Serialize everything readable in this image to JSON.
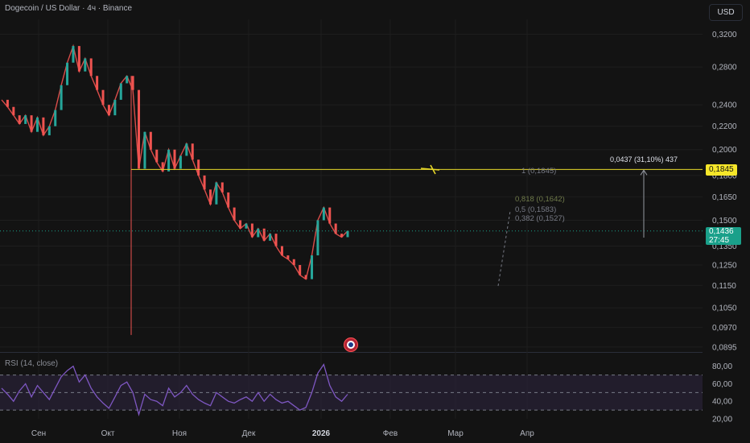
{
  "header": {
    "title": "Dogecoin / US Dollar · 4ч · Binance",
    "currency_button": "USD"
  },
  "colors": {
    "background": "#131313",
    "grid": "#1e1e1e",
    "candle_up": "#26a69a",
    "candle_down": "#ef5350",
    "level_line": "#e6d729",
    "rsi_line": "#7e57c2",
    "rsi_band": "#2a2238",
    "current_price": "#1aa08a"
  },
  "price_axis": {
    "ticks": [
      "0,3200",
      "0,2800",
      "0,2400",
      "0,2200",
      "0,2000",
      "0,1800",
      "0,1650",
      "0,1500",
      "0,1350",
      "0,1250",
      "0,1150",
      "0,1050",
      "0,0970",
      "0,0895"
    ]
  },
  "time_axis": {
    "ticks": [
      "Сен",
      "Окт",
      "Ноя",
      "Дек",
      "2026",
      "Фев",
      "Мар",
      "Апр"
    ]
  },
  "rsi": {
    "label": "RSI (14, close)",
    "ticks": [
      "80,00",
      "60,00",
      "40,00",
      "20,00"
    ]
  },
  "annotations": {
    "level_price_tag": "0,1845",
    "current_price_tag": "0,1436",
    "countdown": "27:45",
    "measure_label": "0,0437 (31,10%) 437",
    "fib_1": "1 (0,1845)",
    "fib_0818": "0,818 (0,1642)",
    "fib_05": "0,5 (0,1583)",
    "fib_0382": "0,382 (0,1527)"
  },
  "chart_data": {
    "type": "line",
    "title": "Dogecoin / US Dollar · 4ч · Binance",
    "xlabel": "",
    "ylabel": "",
    "log_scale": true,
    "ylim": [
      0.088,
      0.34
    ],
    "x_categories": [
      "Сен",
      "Окт",
      "Ноя",
      "Дек",
      "2026",
      "Фев",
      "Мар",
      "Апр"
    ],
    "series": [
      {
        "values": [
          0.245,
          0.238,
          0.23,
          0.222,
          0.23,
          0.215,
          0.228,
          0.212,
          0.22,
          0.235,
          0.26,
          0.285,
          0.305,
          0.275,
          0.29,
          0.27,
          0.255,
          0.24,
          0.23,
          0.245,
          0.262,
          0.27,
          0.255,
          0.185,
          0.215,
          0.2,
          0.19,
          0.183,
          0.2,
          0.185,
          0.195,
          0.205,
          0.192,
          0.18,
          0.17,
          0.16,
          0.175,
          0.168,
          0.158,
          0.15,
          0.145,
          0.148,
          0.14,
          0.145,
          0.138,
          0.142,
          0.135,
          0.13,
          0.128,
          0.125,
          0.12,
          0.118,
          0.13,
          0.15,
          0.158,
          0.148,
          0.142,
          0.14,
          0.1436
        ]
      }
    ],
    "horizontal_level": 0.1845,
    "current_price": 0.1436,
    "rsi": {
      "ylim": [
        20,
        88
      ],
      "bands": [
        70,
        50,
        30
      ],
      "values": [
        55,
        48,
        40,
        52,
        60,
        45,
        58,
        50,
        42,
        55,
        68,
        75,
        80,
        62,
        70,
        55,
        45,
        38,
        32,
        45,
        58,
        62,
        50,
        25,
        48,
        42,
        40,
        35,
        55,
        45,
        50,
        58,
        48,
        42,
        38,
        35,
        50,
        45,
        40,
        38,
        42,
        45,
        40,
        50,
        40,
        48,
        42,
        38,
        40,
        35,
        30,
        33,
        50,
        72,
        82,
        58,
        45,
        40,
        48
      ]
    }
  }
}
